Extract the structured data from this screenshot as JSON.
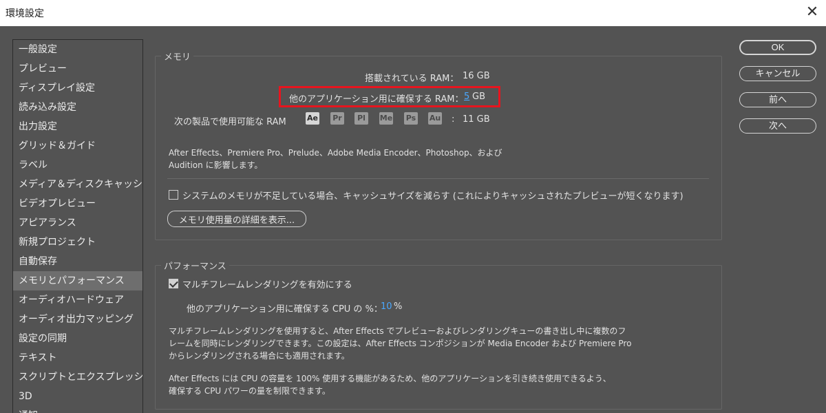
{
  "window": {
    "title": "環境設定",
    "close_icon": "✕"
  },
  "sidebar": {
    "items": [
      "一般設定",
      "プレビュー",
      "ディスプレイ設定",
      "読み込み設定",
      "出力設定",
      "グリッド＆ガイド",
      "ラベル",
      "メディア＆ディスクキャッシュ",
      "ビデオプレビュー",
      "アピアランス",
      "新規プロジェクト",
      "自動保存",
      "メモリとパフォーマンス",
      "オーディオハードウェア",
      "オーディオ出力マッピング",
      "設定の同期",
      "テキスト",
      "スクリプトとエクスプレッション",
      "3D",
      "通知"
    ],
    "selected_index": 12
  },
  "memory": {
    "title": "メモリ",
    "installed_label": "搭載されている RAM：",
    "installed_value": "16 GB",
    "reserved_label": "他のアプリケーション用に確保する RAM：",
    "reserved_value": "5",
    "reserved_unit": "GB",
    "available_label": "次の製品で使用可能な RAM",
    "apps": [
      "Ae",
      "Pr",
      "Pl",
      "Me",
      "Ps",
      "Au"
    ],
    "available_sep": ":",
    "available_value": "11 GB",
    "note_line1": "After Effects、Premiere Pro、Prelude、Adobe Media Encoder、Photoshop、および",
    "note_line2": "Audition に影響します。",
    "reduce_cache_label": "システムのメモリが不足している場合、キャッシュサイズを減らす (これによりキャッシュされたプレビューが短くなります)",
    "reduce_cache_checked": false,
    "details_button": "メモリ使用量の詳細を表示..."
  },
  "performance": {
    "title": "パフォーマンス",
    "multiframe_label": "マルチフレームレンダリングを有効にする",
    "multiframe_checked": true,
    "cpu_label": "他のアプリケーション用に確保する CPU の %：",
    "cpu_value": "10",
    "cpu_unit": "%",
    "desc1_line1": "マルチフレームレンダリングを使用すると、After Effects でプレビューおよびレンダリングキューの書き出し中に複数のフ",
    "desc1_line2": "レームを同時にレンダリングできます。この設定は、After Effects コンポジションが Media Encoder および Premiere Pro",
    "desc1_line3": "からレンダリングされる場合にも適用されます。",
    "desc2_line1": "After Effects には CPU の容量を 100% 使用する機能があるため、他のアプリケーションを引き続き使用できるよう、",
    "desc2_line2": "確保する CPU パワーの量を制限できます。"
  },
  "buttons": {
    "ok": "OK",
    "cancel": "キャンセル",
    "prev": "前へ",
    "next": "次へ"
  },
  "colors": {
    "background": "#535353",
    "selected": "#6e6e6e",
    "accent_value": "#4aa8ff",
    "highlight": "#e8141e"
  }
}
